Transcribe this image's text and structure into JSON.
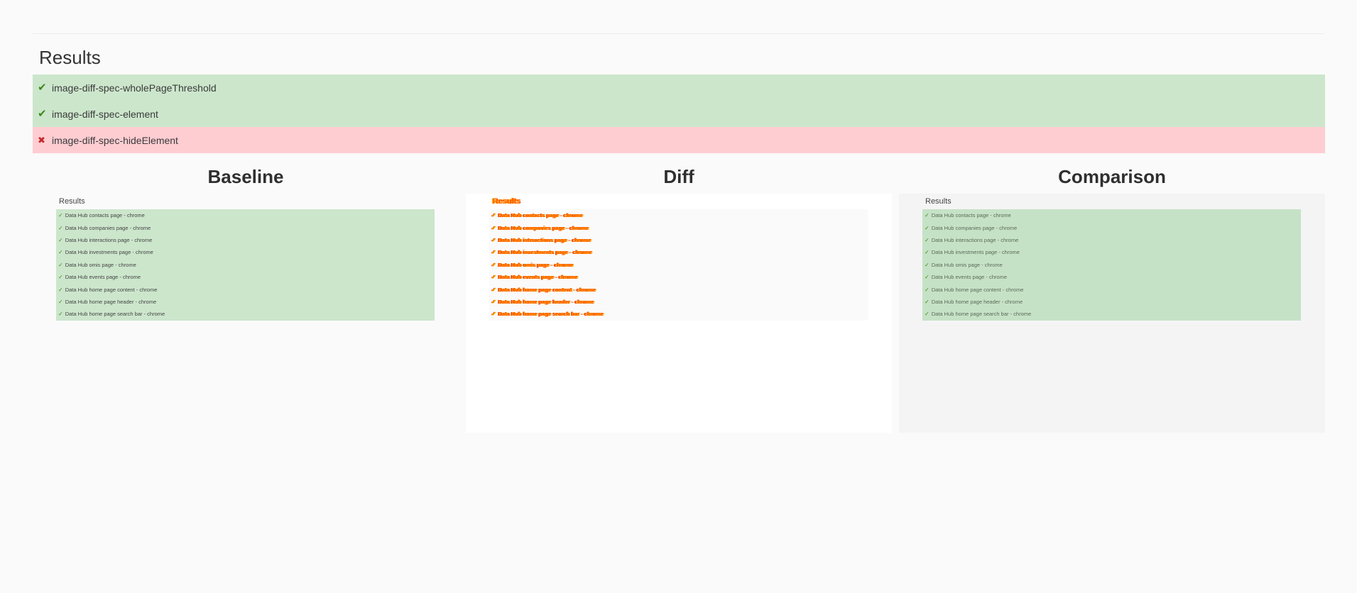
{
  "results": {
    "title": "Results",
    "items": [
      {
        "status": "pass",
        "icon": "✔",
        "label": "image-diff-spec-wholePageThreshold"
      },
      {
        "status": "pass",
        "icon": "✔",
        "label": "image-diff-spec-element"
      },
      {
        "status": "fail",
        "icon": "✖",
        "label": "image-diff-spec-hideElement"
      }
    ]
  },
  "columns": {
    "baseline": "Baseline",
    "diff": "Diff",
    "comparison": "Comparison"
  },
  "snapshot": {
    "title": "Results",
    "check_icon": "✓",
    "rows": [
      "Data Hub contacts page - chrome",
      "Data Hub companies page - chrome",
      "Data Hub interactions page - chrome",
      "Data Hub investments page - chrome",
      "Data Hub omis page - chrome",
      "Data Hub events page - chrome",
      "Data Hub home page content - chrome",
      "Data Hub home page header - chrome",
      "Data Hub home page search bar - chrome"
    ]
  },
  "colors": {
    "pass_bg": "#cce6cc",
    "fail_bg": "#fecdd2",
    "diff_highlight": "#ff5500"
  }
}
